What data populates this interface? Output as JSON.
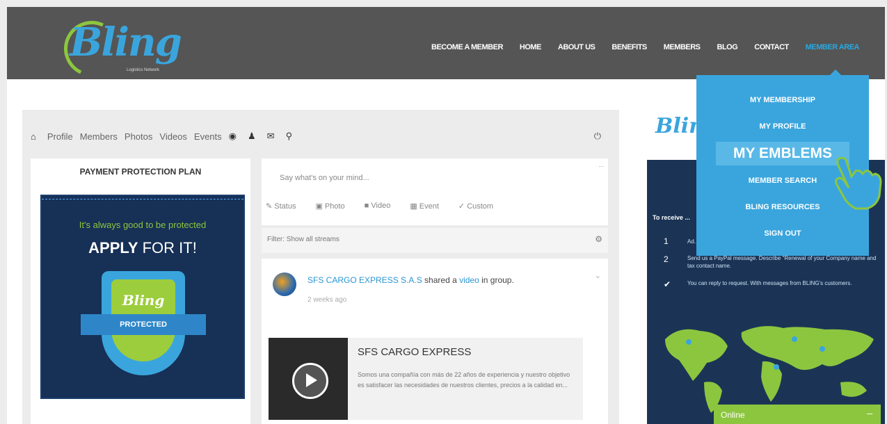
{
  "brand": {
    "name": "Bling",
    "tagline": "Logistics Network"
  },
  "nav": {
    "items": [
      "BECOME A MEMBER",
      "HOME",
      "ABOUT US",
      "BENEFITS",
      "MEMBERS",
      "BLOG",
      "CONTACT",
      "MEMBER AREA"
    ],
    "active_index": 7
  },
  "dropdown": {
    "items": [
      "MY MEMBERSHIP",
      "MY PROFILE",
      "MY EMBLEMS",
      "MEMBER SEARCH",
      "BLING RESOURCES",
      "SIGN OUT"
    ],
    "highlighted": "MY EMBLEMS"
  },
  "toolbar": {
    "links": [
      "Profile",
      "Members",
      "Photos",
      "Videos",
      "Events"
    ]
  },
  "left_card": {
    "title": "PAYMENT PROTECTION PLAN",
    "ad_line1": "It's always good to be protected",
    "ad_line2_bold": "APPLY",
    "ad_line2_rest": " FOR IT!",
    "shield_logo": "Bling",
    "ribbon": "PROTECTED"
  },
  "composer": {
    "placeholder": "Say what's on your mind...",
    "tabs": [
      "Status",
      "Photo",
      "Video",
      "Event",
      "Custom"
    ]
  },
  "filter": {
    "label": "Filter: Show all streams"
  },
  "activity": {
    "actor": "SFS CARGO EXPRESS S.A.S",
    "verb": " shared a ",
    "object": "video",
    "tail": " in group.",
    "time": "2 weeks ago",
    "embed_title": "SFS CARGO EXPRESS",
    "embed_desc": "Somos una compañía con más de 22 años de experiencia y nuestro objetivo es satisfacer las necesidades de nuestros clientes, precios a la calidad en..."
  },
  "right": {
    "logo": "Bling",
    "line1": "To receive ...",
    "items": [
      {
        "icon": "1",
        "text": "Ad..."
      },
      {
        "icon": "2",
        "text": "Send us a PayPal message. Describe \"Renewal of your Company name and tax contact name."
      },
      {
        "icon": "check",
        "text": "You can reply to request. With messages from BLING's customers."
      }
    ]
  },
  "chat": {
    "label": "Online",
    "toggle": "–"
  },
  "colors": {
    "topbar": "#555555",
    "accent_blue": "#3aa5dd",
    "accent_green": "#8cc63f",
    "navy": "#1b3456"
  }
}
